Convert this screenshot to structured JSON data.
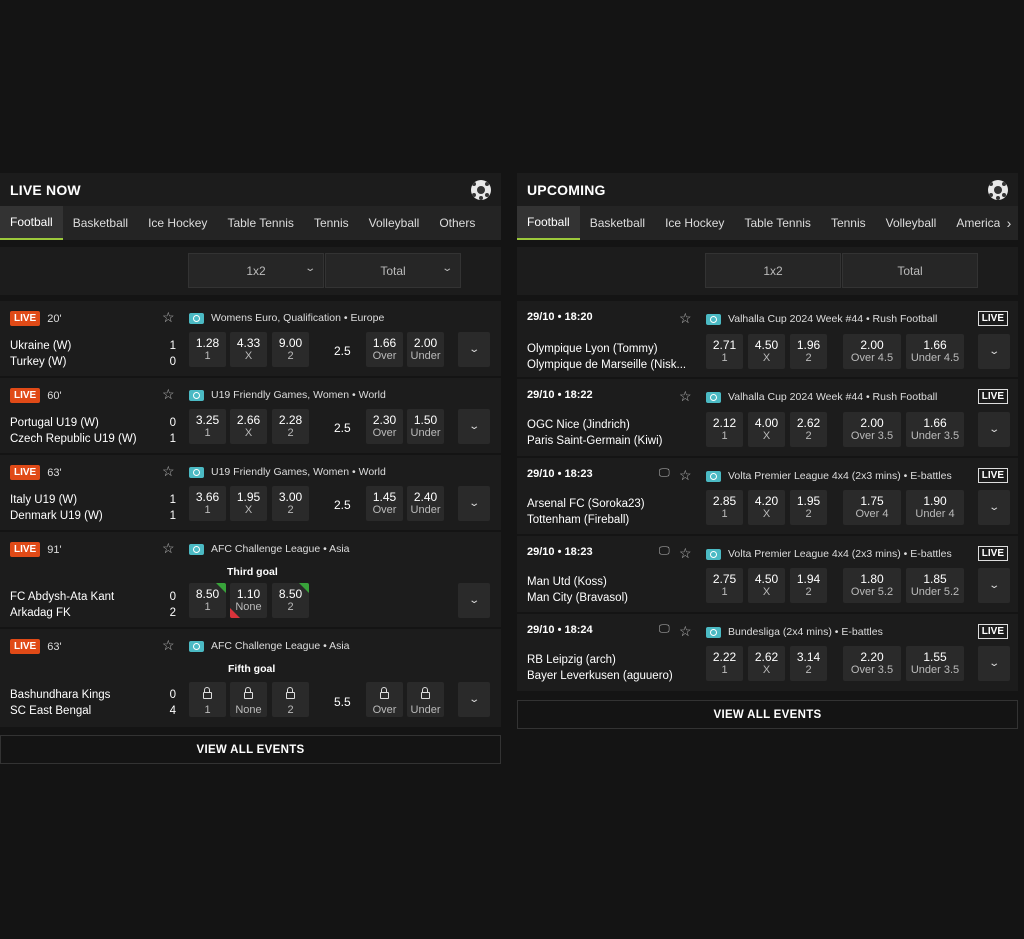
{
  "live": {
    "title": "LIVE NOW",
    "tabs": [
      "Football",
      "Basketball",
      "Ice Hockey",
      "Table Tennis",
      "Tennis",
      "Volleyball",
      "Others"
    ],
    "markets": [
      "1x2",
      "Total"
    ],
    "events": [
      {
        "status": "LIVE",
        "minute": "20'",
        "competition": "Womens Euro, Qualification • Europe",
        "home": "Ukraine (W)",
        "away": "Turkey (W)",
        "home_score": "1",
        "away_score": "0",
        "odds": [
          "1.28",
          "4.33",
          "9.00"
        ],
        "labels": [
          "1",
          "X",
          "2"
        ],
        "line": "2.5",
        "total_odds": [
          "1.66",
          "2.00"
        ],
        "total_labels": [
          "Over",
          "Under"
        ]
      },
      {
        "status": "LIVE",
        "minute": "60'",
        "competition": "U19 Friendly Games, Women • World",
        "home": "Portugal U19 (W)",
        "away": "Czech Republic U19 (W)",
        "home_score": "0",
        "away_score": "1",
        "odds": [
          "3.25",
          "2.66",
          "2.28"
        ],
        "labels": [
          "1",
          "X",
          "2"
        ],
        "line": "2.5",
        "total_odds": [
          "2.30",
          "1.50"
        ],
        "total_labels": [
          "Over",
          "Under"
        ]
      },
      {
        "status": "LIVE",
        "minute": "63'",
        "competition": "U19 Friendly Games, Women • World",
        "home": "Italy U19 (W)",
        "away": "Denmark U19 (W)",
        "home_score": "1",
        "away_score": "1",
        "odds": [
          "3.66",
          "1.95",
          "3.00"
        ],
        "labels": [
          "1",
          "X",
          "2"
        ],
        "line": "2.5",
        "total_odds": [
          "1.45",
          "2.40"
        ],
        "total_labels": [
          "Over",
          "Under"
        ]
      },
      {
        "status": "LIVE",
        "minute": "91'",
        "competition": "AFC Challenge League • Asia",
        "market_label": "Third goal",
        "home": "FC Abdysh-Ata Kant",
        "away": "Arkadag FK",
        "home_score": "0",
        "away_score": "2",
        "odds": [
          "8.50",
          "1.10",
          "8.50"
        ],
        "labels": [
          "1",
          "None",
          "2"
        ]
      },
      {
        "status": "LIVE",
        "minute": "63'",
        "competition": "AFC Challenge League • Asia",
        "market_label": "Fifth goal",
        "home": "Bashundhara Kings",
        "away": "SC East Bengal",
        "home_score": "0",
        "away_score": "4",
        "labels": [
          "1",
          "None",
          "2"
        ],
        "line": "5.5",
        "total_labels": [
          "Over",
          "Under"
        ]
      }
    ],
    "view_all": "VIEW ALL EVENTS"
  },
  "upcoming": {
    "title": "UPCOMING",
    "tabs": [
      "Football",
      "Basketball",
      "Ice Hockey",
      "Table Tennis",
      "Tennis",
      "Volleyball",
      "American"
    ],
    "markets": [
      "1x2",
      "Total"
    ],
    "live_tag": "LIVE",
    "events": [
      {
        "time": "29/10 • 18:20",
        "competition": "Valhalla Cup 2024 Week #44 • Rush Football",
        "home": "Olympique Lyon (Tommy)",
        "away": "Olympique de Marseille (Nisk...",
        "odds": [
          "2.71",
          "4.50",
          "1.96"
        ],
        "labels": [
          "1",
          "X",
          "2"
        ],
        "total_odds": [
          "2.00",
          "1.66"
        ],
        "total_labels": [
          "Over 4.5",
          "Under 4.5"
        ]
      },
      {
        "time": "29/10 • 18:22",
        "competition": "Valhalla Cup 2024 Week #44 • Rush Football",
        "home": "OGC Nice (Jindrich)",
        "away": "Paris Saint-Germain (Kiwi)",
        "odds": [
          "2.12",
          "4.00",
          "2.62"
        ],
        "labels": [
          "1",
          "X",
          "2"
        ],
        "total_odds": [
          "2.00",
          "1.66"
        ],
        "total_labels": [
          "Over 3.5",
          "Under 3.5"
        ]
      },
      {
        "time": "29/10 • 18:23",
        "competition": "Volta Premier League 4x4 (2x3 mins) • E-battles",
        "home": "Arsenal FC (Soroka23)",
        "away": "Tottenham (Fireball)",
        "odds": [
          "2.85",
          "4.20",
          "1.95"
        ],
        "labels": [
          "1",
          "X",
          "2"
        ],
        "total_odds": [
          "1.75",
          "1.90"
        ],
        "total_labels": [
          "Over 4",
          "Under 4"
        ]
      },
      {
        "time": "29/10 • 18:23",
        "competition": "Volta Premier League 4x4 (2x3 mins) • E-battles",
        "home": "Man Utd (Koss)",
        "away": "Man City (Bravasol)",
        "odds": [
          "2.75",
          "4.50",
          "1.94"
        ],
        "labels": [
          "1",
          "X",
          "2"
        ],
        "total_odds": [
          "1.80",
          "1.85"
        ],
        "total_labels": [
          "Over 5.2",
          "Under 5.2"
        ]
      },
      {
        "time": "29/10 • 18:24",
        "competition": "Bundesliga (2x4 mins) • E-battles",
        "home": "RB Leipzig (arch)",
        "away": "Bayer Leverkusen (aguuero)",
        "odds": [
          "2.22",
          "2.62",
          "3.14"
        ],
        "labels": [
          "1",
          "X",
          "2"
        ],
        "total_odds": [
          "2.20",
          "1.55"
        ],
        "total_labels": [
          "Over 3.5",
          "Under 3.5"
        ]
      }
    ],
    "view_all": "VIEW ALL EVENTS"
  },
  "colors": {
    "live_badge": "#e04a17",
    "active_tab_underline": "#9cc93b",
    "competition_icon": "#4bbac4",
    "odds_up": "#38a33a",
    "odds_down": "#d9333b"
  },
  "icons": [
    "soccer-ball-icon",
    "star-icon",
    "tv-icon",
    "competition-icon",
    "chevron-down-icon",
    "lock-icon",
    "chevron-right-icon"
  ]
}
